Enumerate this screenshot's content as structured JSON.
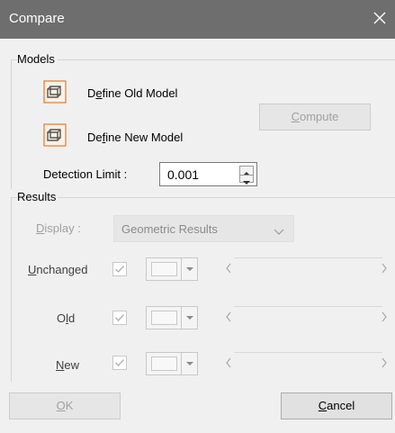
{
  "window": {
    "title": "Compare",
    "close_icon": "close-icon"
  },
  "models": {
    "legend": "Models",
    "define_old": {
      "pre": "D",
      "accel": "e",
      "post": "fine Old Model",
      "icon": "model-frame-icon"
    },
    "define_new": {
      "pre": "De",
      "accel": "f",
      "post": "ine New Model",
      "icon": "model-frame-icon"
    },
    "compute": {
      "accel": "C",
      "post": "ompute",
      "enabled": false
    },
    "detection_limit": {
      "label": "Detection Limit :",
      "value": "0.001"
    }
  },
  "results": {
    "legend": "Results",
    "display": {
      "accel": "D",
      "post": "isplay :",
      "selected": "Geometric Results",
      "enabled": false
    },
    "rows": [
      {
        "pre": "",
        "accel": "U",
        "post": "nchanged",
        "checked": true,
        "enabled": false
      },
      {
        "pre": "O",
        "accel": "l",
        "post": "d",
        "checked": true,
        "enabled": false
      },
      {
        "pre": "",
        "accel": "N",
        "post": "ew",
        "checked": true,
        "enabled": false
      }
    ]
  },
  "footer": {
    "ok": {
      "accel": "O",
      "post": "K",
      "enabled": false
    },
    "cancel": {
      "accel": "C",
      "post": "ancel",
      "enabled": true
    }
  },
  "colors": {
    "titlebar": "#6e6e6e",
    "dialog_bg": "#f0f0f0",
    "icon_orange": "#e07a30",
    "disabled_text": "#a0a0a0"
  }
}
